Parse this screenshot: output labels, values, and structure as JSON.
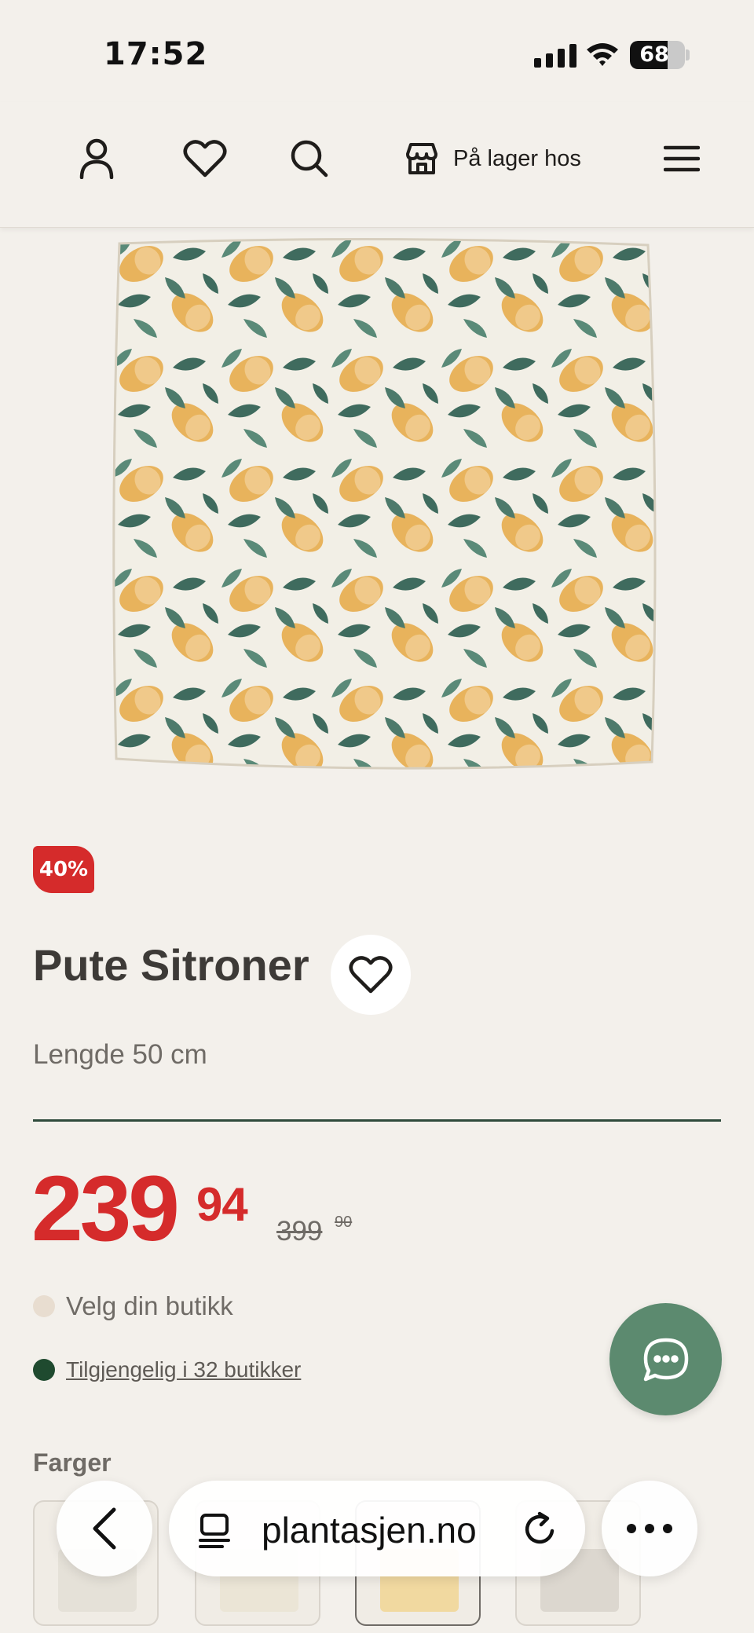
{
  "status_bar": {
    "time": "17:52",
    "battery": "68",
    "battery_level": 0.68
  },
  "header": {
    "store_label": "På lager hos"
  },
  "product": {
    "discount": "40%",
    "title": "Pute Sitroner",
    "size": "Lengde 50 cm",
    "price": {
      "whole": "239",
      "cents": "94",
      "old_whole": "399",
      "old_cents": "90"
    },
    "store_select_label": "Velg din butikk",
    "availability": "Tilgjengelig i 32 butikker"
  },
  "colors": {
    "label": "Farger"
  },
  "browser": {
    "url": "plantasjen.no"
  },
  "colors_palette": {
    "accent": "#d52b2b",
    "green": "#2e4a3b",
    "chat": "#5c8a6f",
    "bg": "#f3f0eb"
  }
}
